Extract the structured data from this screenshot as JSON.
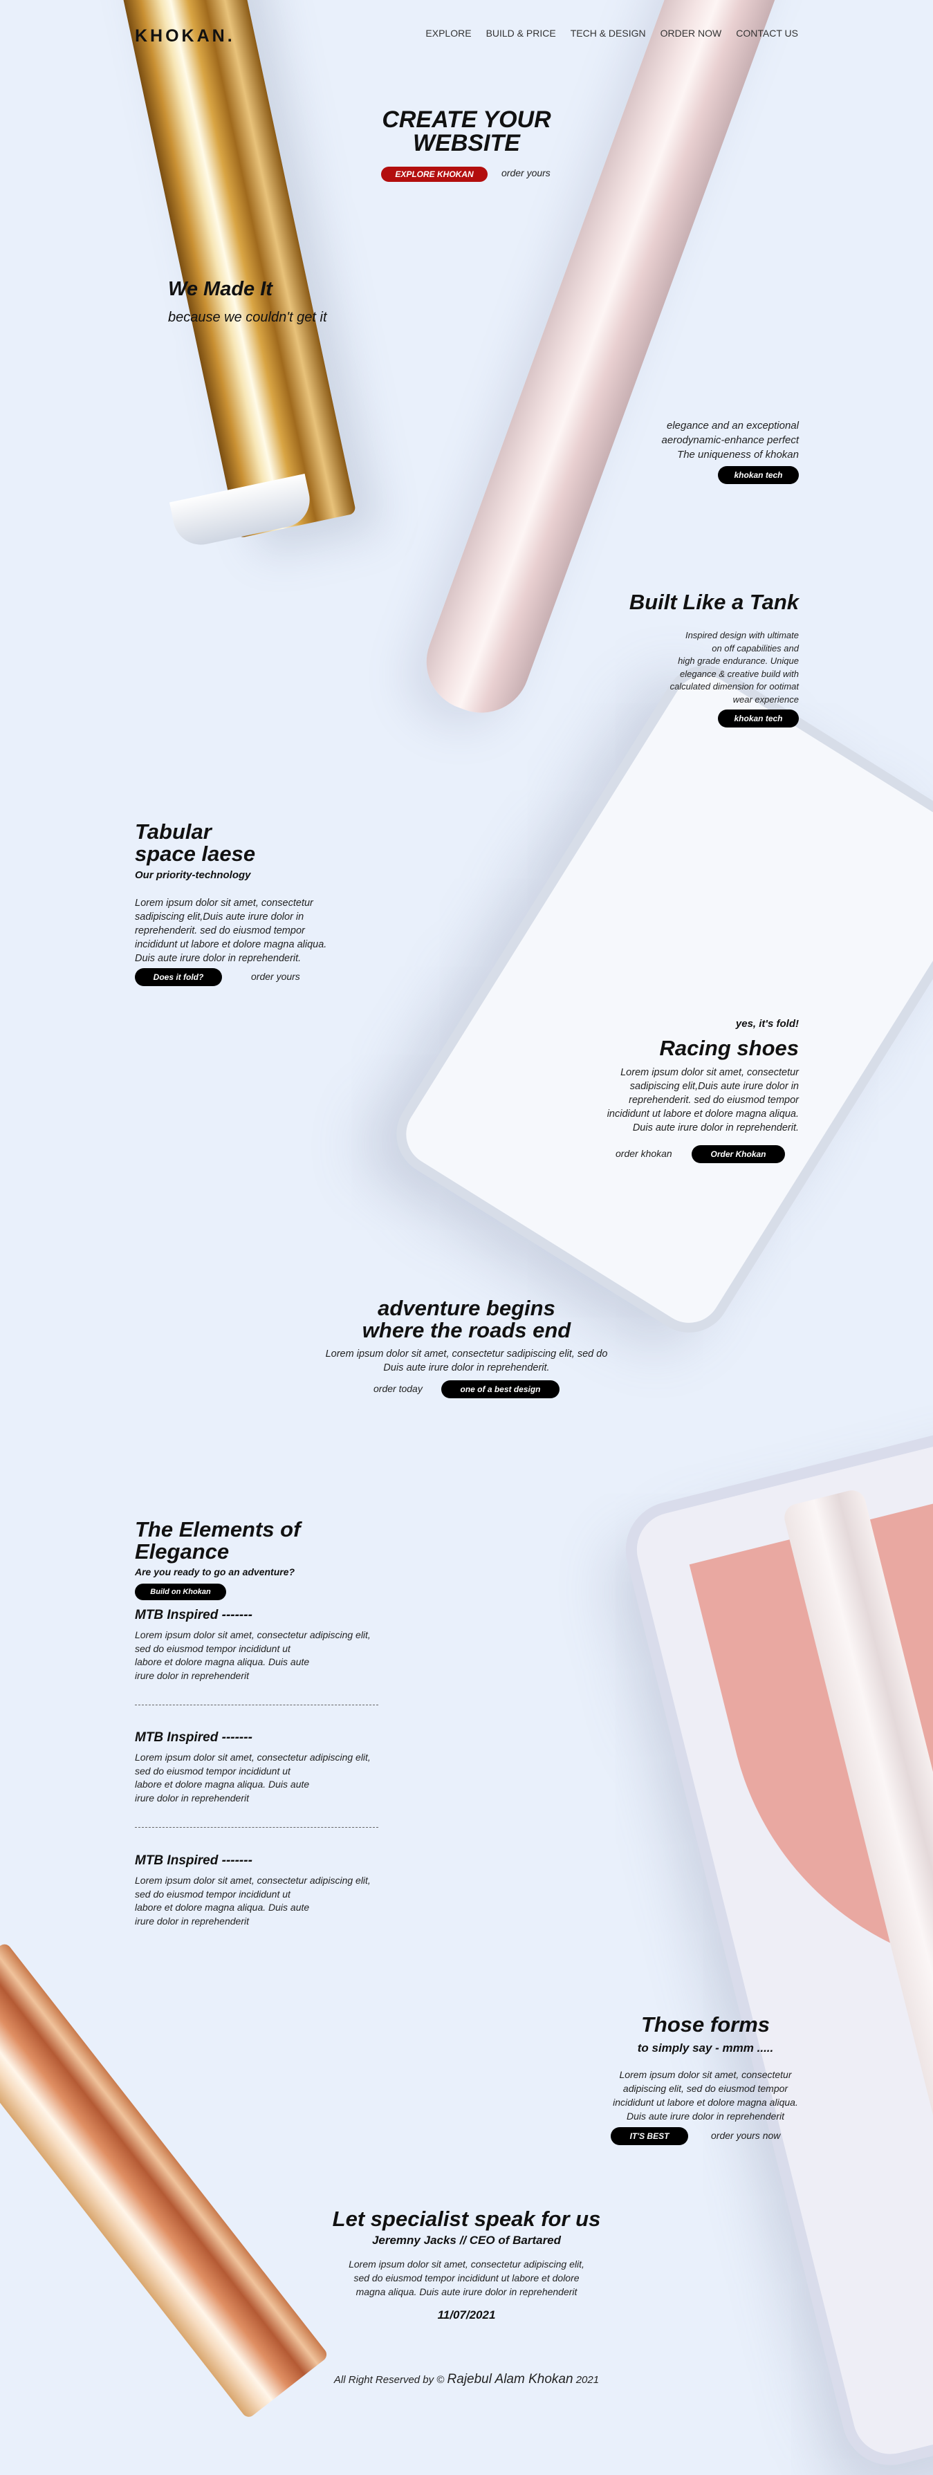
{
  "header": {
    "logo": "KHOKAN.",
    "nav": [
      "EXPLORE",
      "BUILD & PRICE",
      "TECH & DESIGN",
      "ORDER NOW",
      "CONTACT US"
    ]
  },
  "hero": {
    "title_line1": "CREATE YOUR",
    "title_line2": "WEBSITE",
    "primary_button": "EXPLORE KHOKAN",
    "secondary_link": "order yours"
  },
  "made": {
    "title": "We Made It",
    "subtitle": "because we couldn't get it"
  },
  "elegance": {
    "line1": "elegance and an exceptional",
    "line2": "aerodynamic-enhance perfect",
    "line3": "The uniqueness of khokan",
    "button": "khokan tech"
  },
  "tank": {
    "title": "Built Like a Tank",
    "lines": [
      "Inspired design with ultimate",
      "on off capabilities and",
      "high grade endurance. Unique",
      "elegance & creative build with",
      "calculated dimension for ootimat",
      "wear experience"
    ],
    "button": "khokan tech"
  },
  "tabular": {
    "title_line1": "Tabular",
    "title_line2": "space laese",
    "subtitle": "Our priority-technology",
    "lines": [
      "Lorem ipsum dolor sit amet, consectetur",
      "sadipiscing elit,Duis aute irure dolor in",
      "reprehenderit. sed do eiusmod tempor",
      "incididunt ut labore et dolore magna aliqua.",
      "Duis aute irure dolor in reprehenderit."
    ],
    "button": "Does it fold?",
    "link": "order yours"
  },
  "racing": {
    "kicker": "yes, it's fold!",
    "title": "Racing shoes",
    "lines": [
      "Lorem ipsum dolor sit amet, consectetur",
      "sadipiscing elit,Duis aute irure dolor in",
      "reprehenderit. sed do eiusmod tempor",
      "incididunt ut labore et dolore magna aliqua.",
      "Duis aute irure dolor in reprehenderit."
    ],
    "link": "order khokan",
    "button": "Order Khokan"
  },
  "adventure": {
    "title_line1": "adventure begins",
    "title_line2": "where the roads end",
    "line1": "Lorem ipsum dolor sit amet, consectetur sadipiscing elit, sed do",
    "line2": "Duis aute irure dolor in reprehenderit.",
    "link": "order today",
    "button": "one of a best design"
  },
  "elements": {
    "title_line1": "The Elements of",
    "title_line2": "Elegance",
    "subtitle": "Are you ready to go an adventure?",
    "button": "Build on Khokan",
    "items": [
      {
        "heading": "MTB Inspired -------",
        "lines": [
          "Lorem ipsum dolor sit amet, consectetur adipiscing elit,",
          "sed do eiusmod tempor incididunt ut",
          "labore et dolore magna aliqua. Duis aute",
          "irure dolor in reprehenderit"
        ]
      },
      {
        "heading": "MTB Inspired -------",
        "lines": [
          "Lorem ipsum dolor sit amet, consectetur adipiscing elit,",
          "sed do eiusmod tempor incididunt ut",
          "labore et dolore magna aliqua. Duis aute",
          "irure dolor in reprehenderit"
        ]
      },
      {
        "heading": "MTB Inspired -------",
        "lines": [
          "Lorem ipsum dolor sit amet, consectetur adipiscing elit,",
          "sed do eiusmod tempor incididunt ut",
          "labore et dolore magna aliqua. Duis aute",
          "irure dolor in reprehenderit"
        ]
      }
    ]
  },
  "forms": {
    "title": "Those forms",
    "subtitle": "to simply say - mmm .....",
    "lines": [
      "Lorem ipsum dolor sit amet, consectetur",
      "adipiscing elit, sed do eiusmod tempor",
      "incididunt ut labore et dolore magna aliqua.",
      "Duis aute irure dolor in reprehenderit"
    ],
    "button": "IT'S BEST",
    "link": "order yours now"
  },
  "specialist": {
    "title": "Let specialist speak for us",
    "author": "Jeremny Jacks // CEO of Bartared",
    "lines": [
      "Lorem ipsum dolor sit amet, consectetur adipiscing elit,",
      "sed do eiusmod tempor incididunt ut labore et dolore",
      "magna aliqua. Duis aute irure dolor in reprehenderit"
    ],
    "date": "11/07/2021"
  },
  "footer": {
    "prefix": "All Right Reserved by ©",
    "name": "Rajebul Alam Khokan",
    "year": "2021"
  }
}
